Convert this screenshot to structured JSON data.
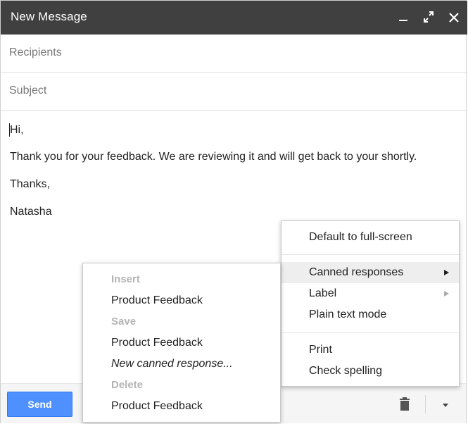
{
  "window": {
    "title": "New Message"
  },
  "fields": {
    "recipients_placeholder": "Recipients",
    "subject_placeholder": "Subject"
  },
  "body": {
    "lines": [
      "Hi,",
      "Thank you for your feedback. We are reviewing it and will get back to your shortly.",
      "Thanks,",
      "Natasha"
    ]
  },
  "toolbar": {
    "send_label": "Send"
  },
  "menu": {
    "items": [
      "Default to full-screen",
      "Canned responses",
      "Label",
      "Plain text mode",
      "Print",
      "Check spelling"
    ]
  },
  "canned_menu": {
    "insert_header": "Insert",
    "insert_item": "Product Feedback",
    "save_header": "Save",
    "save_item": "Product Feedback",
    "new_response": "New canned response...",
    "delete_header": "Delete",
    "delete_item": "Product Feedback"
  },
  "colors": {
    "titlebar": "#404040",
    "send": "#4d90fe",
    "highlight": "#eeeeee"
  },
  "icons": [
    "minimize-icon",
    "fullscreen-icon",
    "close-icon",
    "trash-icon",
    "more-options-icon"
  ]
}
